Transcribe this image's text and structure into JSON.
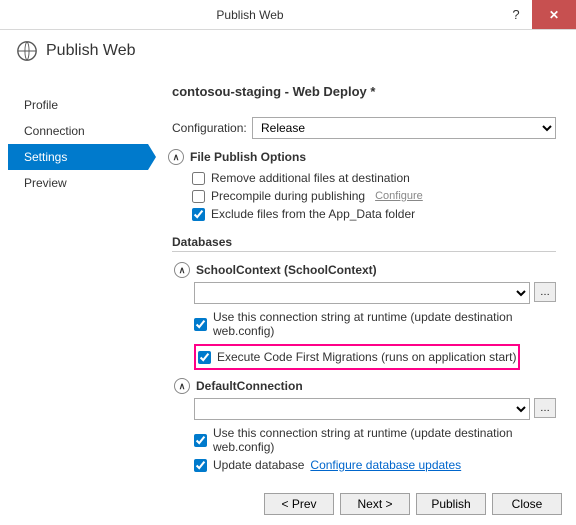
{
  "window": {
    "title": "Publish Web"
  },
  "header": {
    "title": "Publish Web"
  },
  "sidebar": {
    "items": [
      {
        "label": "Profile"
      },
      {
        "label": "Connection"
      },
      {
        "label": "Settings"
      },
      {
        "label": "Preview"
      }
    ]
  },
  "main": {
    "profile_title": "contosou-staging - Web Deploy *",
    "config_label": "Configuration:",
    "config_value": "Release",
    "file_publish_header": "File Publish Options",
    "opt_remove": "Remove additional files at destination",
    "opt_precompile": "Precompile during publishing",
    "opt_precompile_link": "Configure",
    "opt_exclude": "Exclude files from the App_Data folder",
    "db_header": "Databases",
    "db1_name": "SchoolContext (SchoolContext)",
    "db1_usecs": "Use this connection string at runtime (update destination web.config)",
    "db1_ef": "Execute Code First Migrations (runs on application start)",
    "db2_name": "DefaultConnection",
    "db2_usecs": "Use this connection string at runtime (update destination web.config)",
    "db2_update": "Update database",
    "db2_update_link": "Configure database updates"
  },
  "footer": {
    "prev": "< Prev",
    "next": "Next >",
    "publish": "Publish",
    "close": "Close"
  }
}
